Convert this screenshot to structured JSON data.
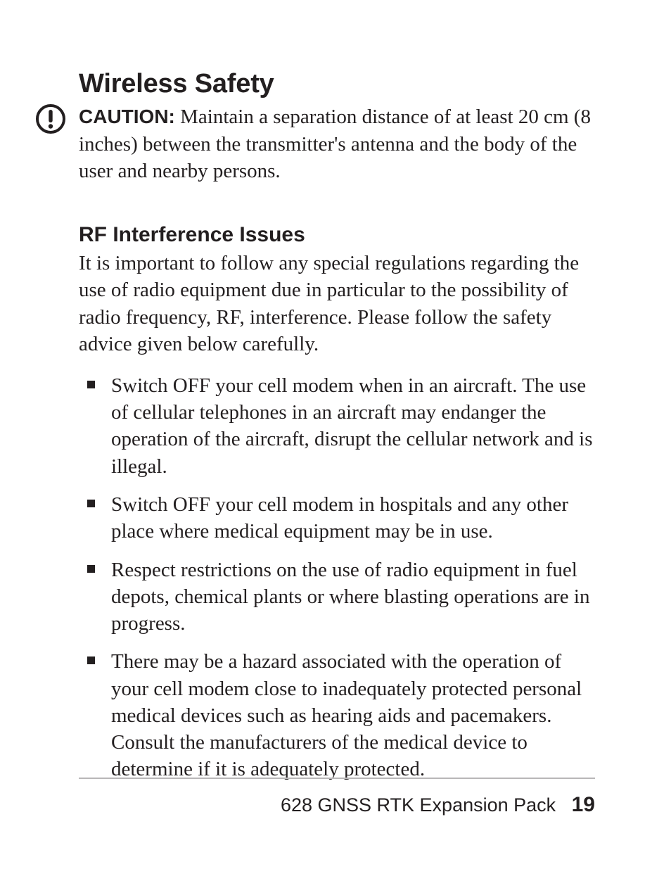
{
  "heading": "Wireless Safety",
  "caution": {
    "label": "CAUTION:",
    "text": "Maintain a separation distance of at least 20 cm (8 inches) between the transmitter's antenna and the body of the user and nearby persons."
  },
  "subheading": "RF Interference Issues",
  "intro": "It is important to follow any special regulations regarding the use of radio equipment due in particular to the possibility of radio frequency, RF, interference. Please follow the safety advice given below carefully.",
  "bullets": [
    "Switch OFF your cell modem when in an aircraft. The use of cellular telephones in an aircraft may endanger the operation of the aircraft, disrupt the cellular network and is illegal.",
    "Switch OFF your cell modem in hospitals and any other place where medical equipment may be in use.",
    "Respect restrictions on the use of radio equipment in fuel depots, chemical plants or where blasting operations are in progress.",
    "There may be a hazard associated with the operation of your cell modem  close to inadequately protected personal medical devices such as hearing aids and pacemakers. Consult the manufacturers of the medical device to determine if it is adequately protected."
  ],
  "footer": {
    "title": "628 GNSS RTK Expansion Pack",
    "page": "19"
  }
}
